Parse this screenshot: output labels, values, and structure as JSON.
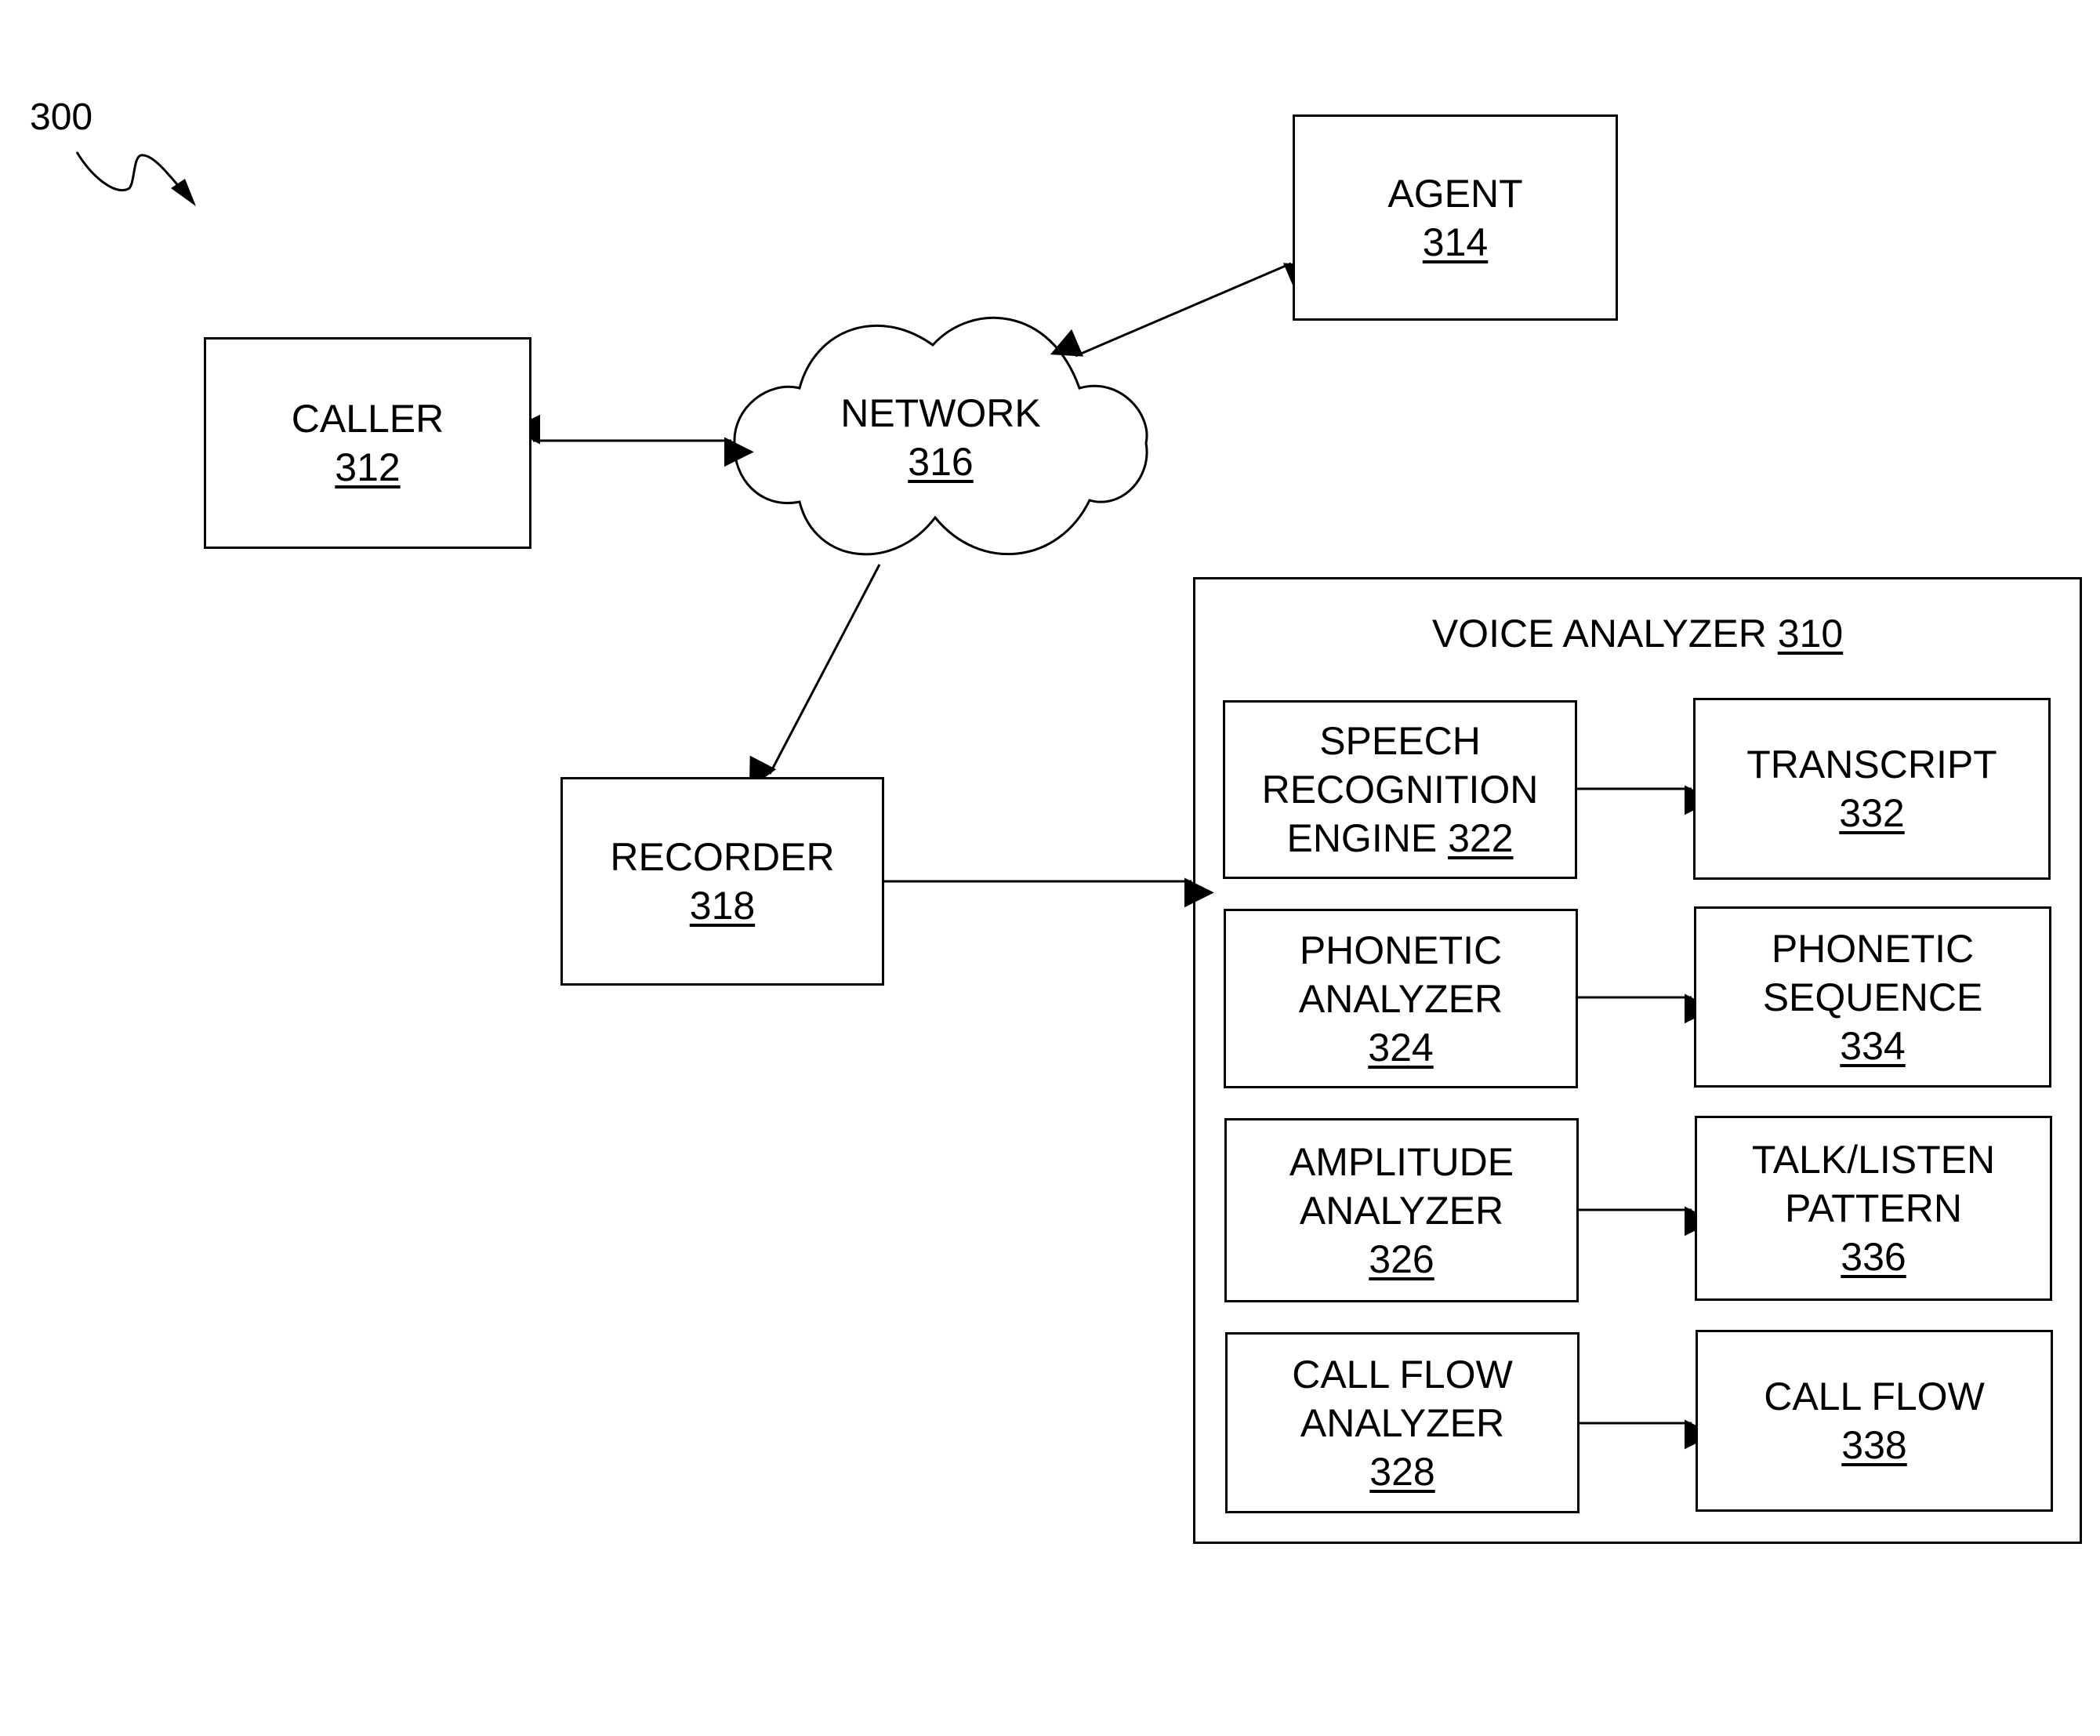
{
  "figure": {
    "number": "300"
  },
  "nodes": {
    "caller": {
      "name": "CALLER",
      "ref": "312"
    },
    "agent": {
      "name": "AGENT",
      "ref": "314"
    },
    "network": {
      "name": "NETWORK",
      "ref": "316"
    },
    "recorder": {
      "name": "RECORDER",
      "ref": "318"
    }
  },
  "voice_analyzer": {
    "title": "VOICE ANALYZER",
    "ref": "310",
    "analyzers": [
      {
        "lines": [
          "SPEECH",
          "RECOGNITION",
          "ENGINE"
        ],
        "ref": "322",
        "ref_inline": true
      },
      {
        "lines": [
          "PHONETIC",
          "ANALYZER"
        ],
        "ref": "324"
      },
      {
        "lines": [
          "AMPLITUDE",
          "ANALYZER"
        ],
        "ref": "326"
      },
      {
        "lines": [
          "CALL FLOW",
          "ANALYZER"
        ],
        "ref": "328"
      }
    ],
    "outputs": [
      {
        "lines": [
          "TRANSCRIPT"
        ],
        "ref": "332"
      },
      {
        "lines": [
          "PHONETIC",
          "SEQUENCE"
        ],
        "ref": "334"
      },
      {
        "lines": [
          "TALK/LISTEN",
          "PATTERN"
        ],
        "ref": "336"
      },
      {
        "lines": [
          "CALL FLOW"
        ],
        "ref": "338"
      }
    ]
  },
  "connections": [
    {
      "from": "caller",
      "to": "network",
      "direction": "bidirectional"
    },
    {
      "from": "network",
      "to": "agent",
      "direction": "bidirectional"
    },
    {
      "from": "network",
      "to": "recorder",
      "direction": "forward"
    },
    {
      "from": "recorder",
      "to": "voice_analyzer",
      "direction": "forward"
    },
    {
      "from": "speech_recognition_engine",
      "to": "transcript",
      "direction": "forward"
    },
    {
      "from": "phonetic_analyzer",
      "to": "phonetic_sequence",
      "direction": "forward"
    },
    {
      "from": "amplitude_analyzer",
      "to": "talk_listen_pattern",
      "direction": "forward"
    },
    {
      "from": "call_flow_analyzer",
      "to": "call_flow",
      "direction": "forward"
    }
  ]
}
